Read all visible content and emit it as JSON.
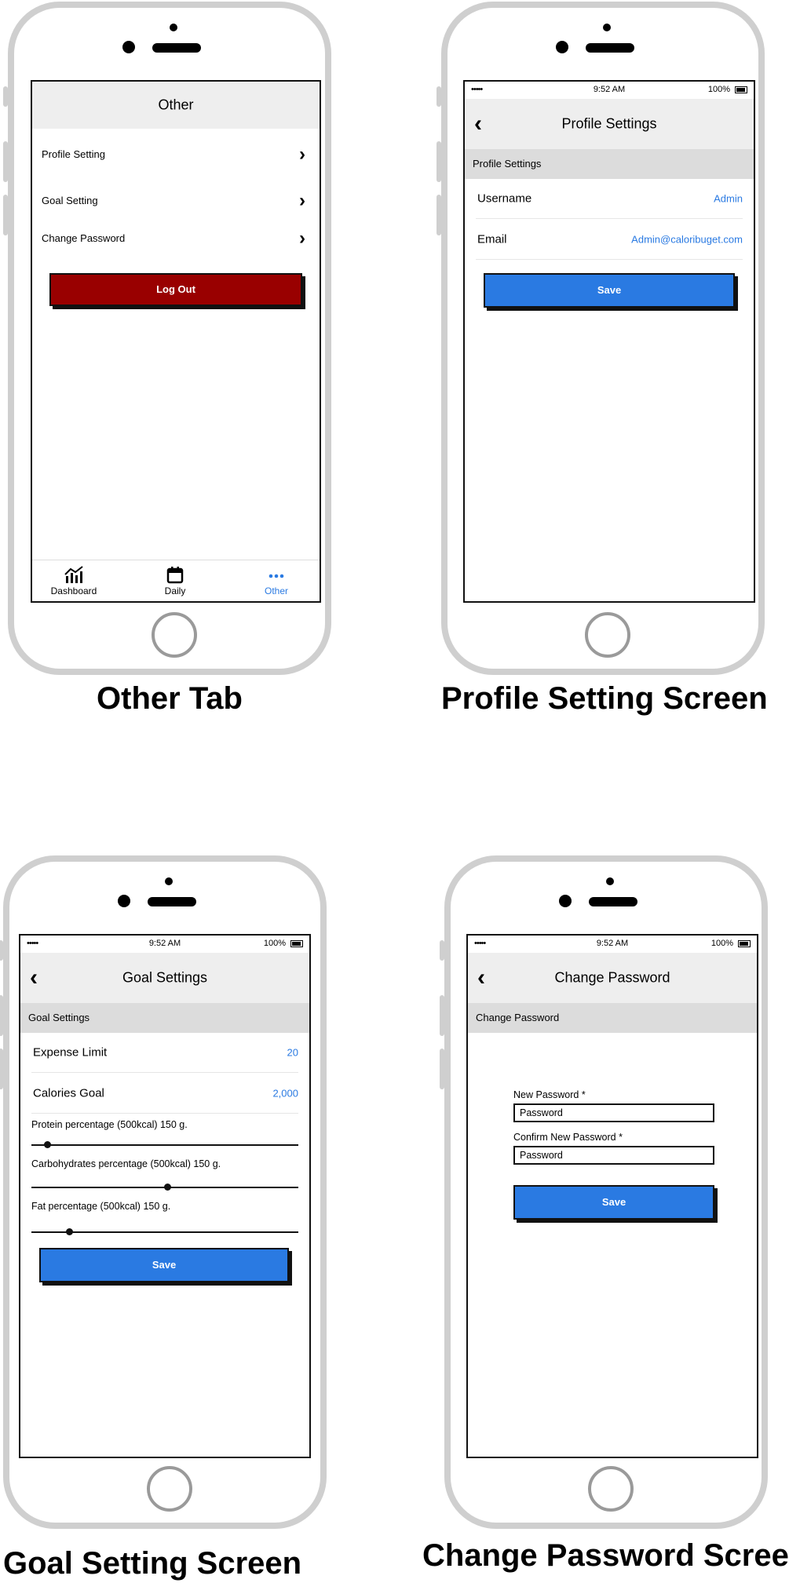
{
  "captions": {
    "other": "Other Tab",
    "profile": "Profile Setting Screen",
    "goal": "Goal Setting Screen",
    "password": "Change Password Screen"
  },
  "status_bar": {
    "signal": "•••••",
    "time": "9:52 AM",
    "battery": "100%"
  },
  "other_tab": {
    "header": "Other",
    "menu": [
      {
        "label": "Profile Setting",
        "icon": "chevron-right-icon"
      },
      {
        "label": "Goal Setting",
        "icon": "chevron-right-icon"
      },
      {
        "label": "Change Password",
        "icon": "chevron-right-icon"
      }
    ],
    "logout_label": "Log Out",
    "tabs": [
      {
        "label": "Dashboard",
        "icon": "chart-icon"
      },
      {
        "label": "Daily",
        "icon": "calendar-icon"
      },
      {
        "label": "Other",
        "icon": "more-icon",
        "active": true
      }
    ]
  },
  "profile_settings": {
    "title": "Profile Settings",
    "section": "Profile Settings",
    "fields": [
      {
        "label": "Username",
        "value": "Admin"
      },
      {
        "label": "Email",
        "value": "Admin@caloribuget.com"
      }
    ],
    "save_label": "Save"
  },
  "goal_settings": {
    "title": "Goal Settings",
    "section": "Goal Settings",
    "fields": [
      {
        "label": "Expense Limit",
        "value": "20"
      },
      {
        "label": "Calories Goal",
        "value": "2,000"
      }
    ],
    "sliders": [
      {
        "label": "Protein percentage (500kcal) 150 g.",
        "level": 0.06
      },
      {
        "label": "Carbohydrates percentage (500kcal) 150 g.",
        "level": 0.51
      },
      {
        "label": "Fat percentage (500kcal) 150 g.",
        "level": 0.14
      }
    ],
    "save_label": "Save"
  },
  "change_password": {
    "title": "Change Password",
    "section": "Change Password",
    "new_label": "New Password *",
    "new_value": "Password",
    "confirm_label": "Confirm New Password *",
    "confirm_value": "Password",
    "save_label": "Save"
  },
  "colors": {
    "accent": "#2a7ae2",
    "danger": "#990000",
    "header": "#eeeeee",
    "section": "#dcdcdc"
  }
}
